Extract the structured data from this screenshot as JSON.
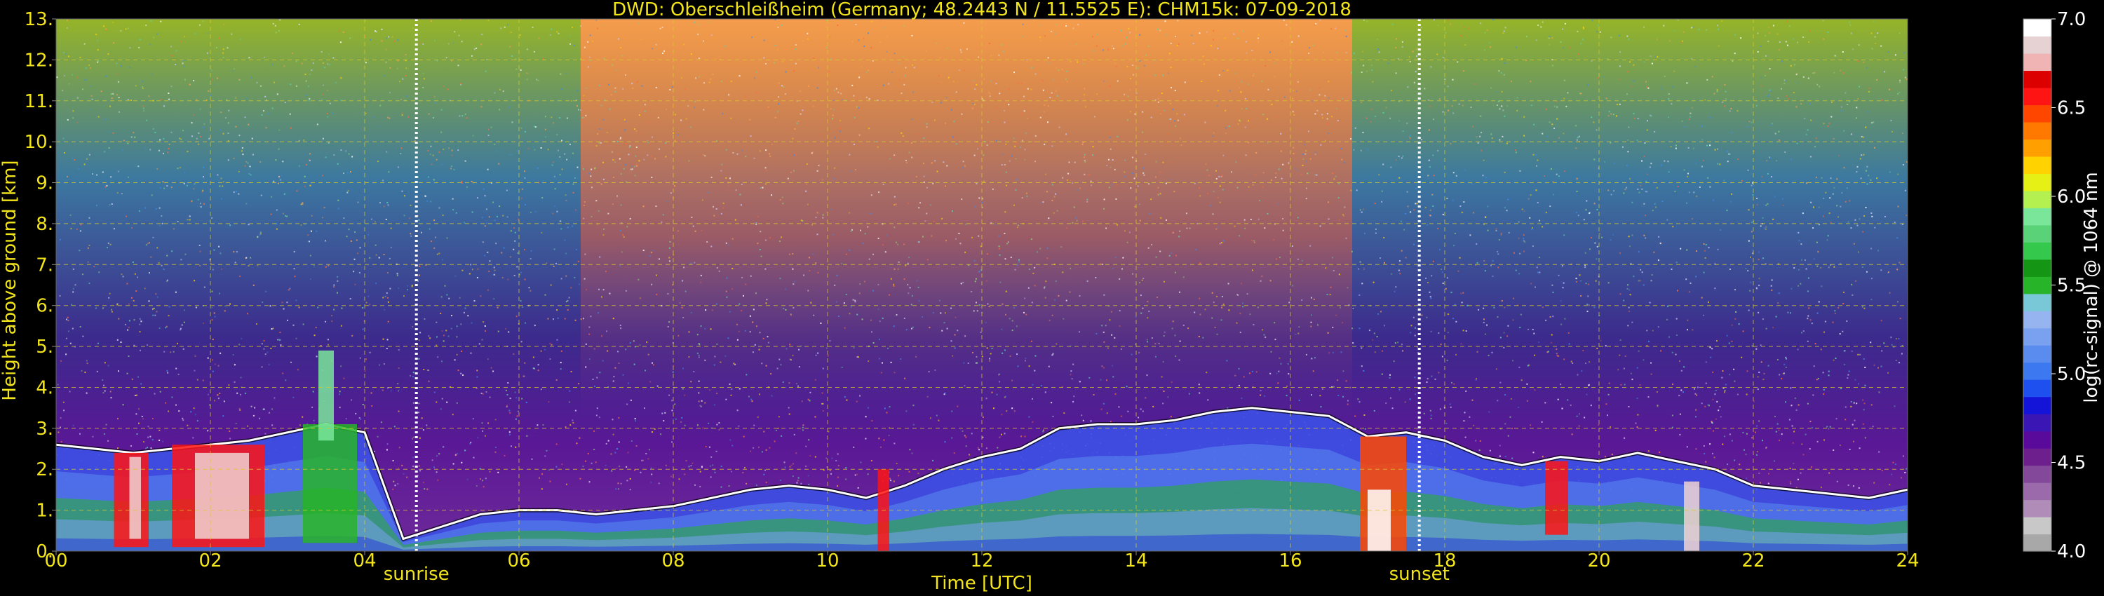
{
  "colors": {
    "background": "#000000",
    "text_yellow": "#f2e41a",
    "text_white": "#ffffff",
    "grid": "#d9c92a",
    "marker_white": "#ffffff"
  },
  "chart_data": {
    "type": "heatmap",
    "title": "DWD: Oberschleißheim (Germany; 48.2443 N / 11.5525 E):    CHM15k: 07-09-2018",
    "xlabel": "Time [UTC]",
    "ylabel": "Height above ground [km]",
    "xlim": [
      0,
      24
    ],
    "ylim": [
      0,
      13
    ],
    "x_ticks": [
      0,
      2,
      4,
      6,
      8,
      10,
      12,
      14,
      16,
      18,
      20,
      22,
      24
    ],
    "x_tick_labels": [
      "00",
      "02",
      "04",
      "06",
      "08",
      "10",
      "12",
      "14",
      "16",
      "18",
      "20",
      "22",
      "24"
    ],
    "y_ticks": [
      0,
      1,
      2,
      3,
      4,
      5,
      6,
      7,
      8,
      9,
      10,
      11,
      12,
      13
    ],
    "y_tick_labels": [
      "0.",
      "1.",
      "2.",
      "3.",
      "4.",
      "5.",
      "6.",
      "7.",
      "8.",
      "9.",
      "10.",
      "11.",
      "12.",
      "13."
    ],
    "grid": true,
    "annotations": [
      {
        "label": "sunrise",
        "x": 4.67
      },
      {
        "label": "sunset",
        "x": 17.67
      }
    ],
    "colorbar": {
      "label": "log(rc-signal) @ 1064 nm",
      "range": [
        4.0,
        7.0
      ],
      "ticks": [
        4.0,
        4.5,
        5.0,
        5.5,
        6.0,
        6.5,
        7.0
      ],
      "tick_labels": [
        "4.0",
        "4.5",
        "5.0",
        "5.5",
        "6.0",
        "6.5",
        "7.0"
      ],
      "colors": [
        "#a8a8a8",
        "#c8c8c8",
        "#b08cb8",
        "#9a6aaa",
        "#84489a",
        "#6e1f8e",
        "#5a0a9a",
        "#3a16b4",
        "#1414d8",
        "#1e50f0",
        "#3c78f0",
        "#5a8cf0",
        "#7aa0f0",
        "#96b4f0",
        "#78c8d8",
        "#28b428",
        "#149614",
        "#34c84c",
        "#5ad278",
        "#7ae69a",
        "#b4f050",
        "#e6f014",
        "#ffd200",
        "#ffa000",
        "#ff7800",
        "#ff4600",
        "#ff1414",
        "#dc0000",
        "#f0b4b4",
        "#e6d2d2",
        "#ffffff"
      ]
    },
    "layers": [
      {
        "name": "noise-background",
        "description_values": "dense speckle above boundary layer"
      },
      {
        "name": "boundary-layer-top",
        "x": [
          0,
          0.5,
          1,
          1.5,
          2,
          2.5,
          3,
          3.5,
          4,
          4.5,
          5,
          5.5,
          6,
          6.5,
          7,
          7.5,
          8,
          8.5,
          9,
          9.5,
          10,
          10.5,
          11,
          11.5,
          12,
          12.5,
          13,
          13.5,
          14,
          14.5,
          15,
          15.5,
          16,
          16.5,
          17,
          17.5,
          18,
          18.5,
          19,
          19.5,
          20,
          20.5,
          21,
          21.5,
          22,
          22.5,
          23,
          23.5,
          24
        ],
        "y": [
          2.6,
          2.5,
          2.4,
          2.5,
          2.6,
          2.7,
          2.9,
          3.1,
          2.9,
          0.3,
          0.6,
          0.9,
          1.0,
          1.0,
          0.9,
          1.0,
          1.1,
          1.3,
          1.5,
          1.6,
          1.5,
          1.3,
          1.6,
          2.0,
          2.3,
          2.5,
          3.0,
          3.1,
          3.1,
          3.2,
          3.4,
          3.5,
          3.4,
          3.3,
          2.8,
          2.9,
          2.7,
          2.3,
          2.1,
          2.3,
          2.2,
          2.4,
          2.2,
          2.0,
          1.6,
          1.5,
          1.4,
          1.3,
          1.5
        ]
      }
    ]
  }
}
